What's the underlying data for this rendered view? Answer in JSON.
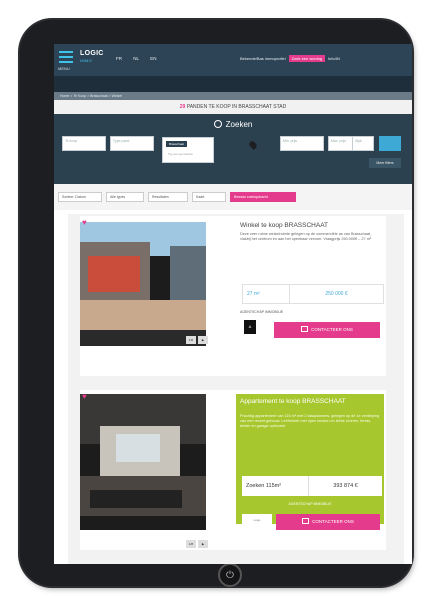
{
  "header": {
    "menu_label": "MENU",
    "logo_main": "LOGIC",
    "logo_sub": "IMMO",
    "languages": [
      "FR",
      "NL",
      "EN"
    ],
    "top_right_text": "Bekende/Bas immoprofiel",
    "top_right_cta": "Zoek een woning",
    "top_right_extra": "Info/IN"
  },
  "breadcrumb": "Home > Te Koop > Brasschaat > Winkel",
  "results_title": {
    "count": "29",
    "text": "PANDEN TE KOOP IN BRASSCHAAT STAD"
  },
  "search": {
    "title": "Zoeken",
    "field1": "Te koop",
    "field2": "Type pand",
    "chip": "Brasschaat",
    "chip_sub": "Typ een gemeente",
    "field3": "Min. prijs",
    "field4": "Max. prijs",
    "field5": "Slpk",
    "more_button": "Meer filters"
  },
  "sort": {
    "label1": "Sorteer: Datum",
    "label2": "Alle types",
    "label3": "Resultaten",
    "label4": "Kaart",
    "pink": "Bewaar zoekopdracht"
  },
  "listings": [
    {
      "title": "Winkel te koop BRASSCHAAT",
      "description": "Deze zeer ruime winkelruimte gelegen op de commerciële as van Brasschaat, vlakbij het centrum en aan het openbaar vervoer. Vraagprijs 250.000€ – 27 m²",
      "area": "27 m²",
      "price": "250 000 €",
      "agent_label": "AGENTSCHAP IMMOBILIE",
      "agent_logo": "A",
      "cta": "CONTACTEER ONS",
      "thumb1": "1/8"
    },
    {
      "title": "Appartement te koop BRASSCHAAT",
      "description": "Prachtig appartement van 115 m² met 2 slaapkamers, gelegen op de 1e verdieping van een recent gebouw. Leefruimte met open keuken en lichte vloeren, terras, kelder en garage optioneel.",
      "area": "Zoeken 115m²",
      "price": "393 874 €",
      "agent_label": "AGENTSCHAP IMMOBILIE",
      "agent_logo": "Logo",
      "cta": "CONTACTEER ONS",
      "thumb1": "1/8"
    }
  ],
  "colors": {
    "accent_pink": "#e53b8c",
    "accent_blue": "#3fa9d6",
    "green_card": "#a6c72e",
    "dark_header": "#2d4456"
  }
}
